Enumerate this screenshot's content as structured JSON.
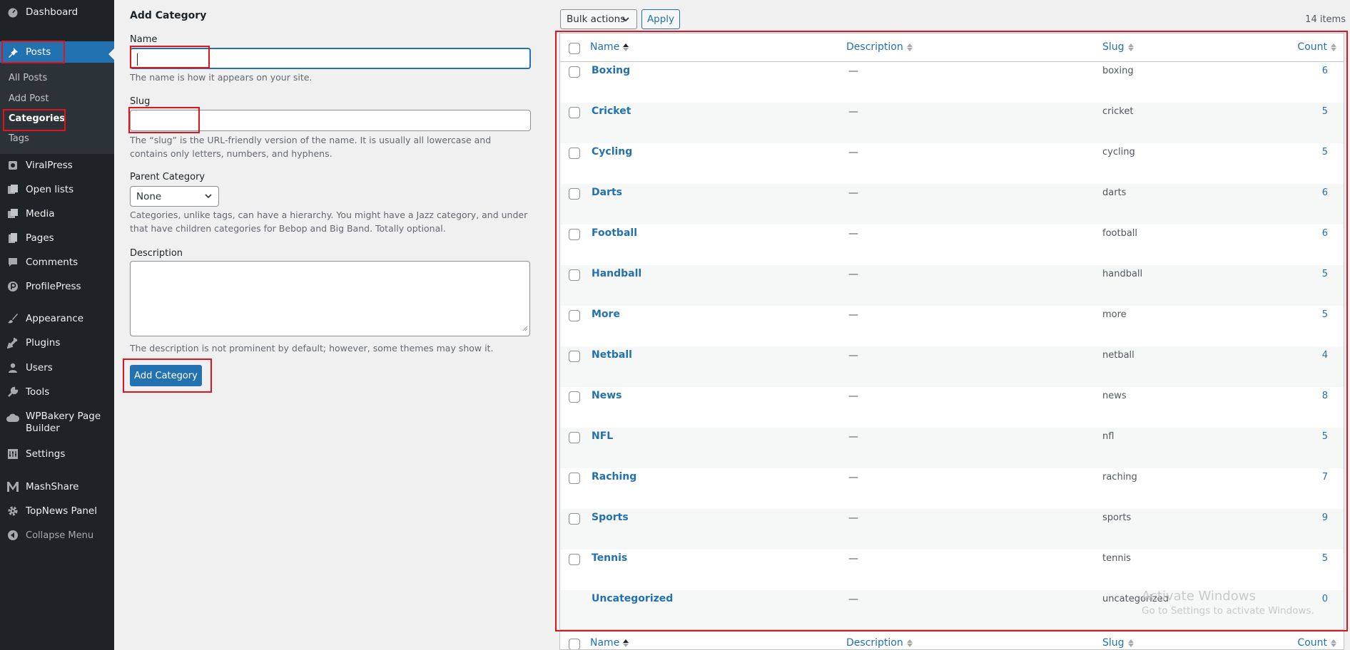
{
  "sidebar": {
    "menu": [
      {
        "label": "Dashboard",
        "icon": "dashboard-icon"
      },
      {
        "label": "Posts",
        "icon": "pushpin-icon"
      },
      {
        "label": "ViralPress",
        "icon": "viralpress-icon"
      },
      {
        "label": "Open lists",
        "icon": "list-icon"
      },
      {
        "label": "Media",
        "icon": "media-icon"
      },
      {
        "label": "Pages",
        "icon": "pages-icon"
      },
      {
        "label": "Comments",
        "icon": "comment-icon"
      },
      {
        "label": "ProfilePress",
        "icon": "profilepress-icon"
      },
      {
        "label": "Appearance",
        "icon": "brush-icon"
      },
      {
        "label": "Plugins",
        "icon": "plug-icon"
      },
      {
        "label": "Users",
        "icon": "user-icon"
      },
      {
        "label": "Tools",
        "icon": "wrench-icon"
      },
      {
        "label": "WPBakery Page Builder",
        "icon": "cloud-icon"
      },
      {
        "label": "Settings",
        "icon": "settings-icon"
      },
      {
        "label": "MashShare",
        "icon": "mashshare-icon"
      },
      {
        "label": "TopNews Panel",
        "icon": "gear-icon"
      },
      {
        "label": "Collapse Menu",
        "icon": "collapse-icon"
      }
    ],
    "posts_submenu": [
      "All Posts",
      "Add Post",
      "Categories",
      "Tags"
    ]
  },
  "form": {
    "heading": "Add Category",
    "name_label": "Name",
    "name_value": "",
    "name_help": "The name is how it appears on your site.",
    "slug_label": "Slug",
    "slug_value": "",
    "slug_help": "The “slug” is the URL-friendly version of the name. It is usually all lowercase and contains only letters, numbers, and hyphens.",
    "parent_label": "Parent Category",
    "parent_selected": "None",
    "parent_help": "Categories, unlike tags, can have a hierarchy. You might have a Jazz category, and under that have children categories for Bebop and Big Band. Totally optional.",
    "description_label": "Description",
    "description_value": "",
    "description_help": "The description is not prominent by default; however, some themes may show it.",
    "submit_label": "Add Category"
  },
  "table": {
    "bulk_actions": "Bulk actions",
    "apply": "Apply",
    "items_count": "14 items",
    "columns": {
      "name": "Name",
      "description": "Description",
      "slug": "Slug",
      "count": "Count"
    },
    "rows": [
      {
        "name": "Boxing",
        "description": "—",
        "slug": "boxing",
        "count": "6"
      },
      {
        "name": "Cricket",
        "description": "—",
        "slug": "cricket",
        "count": "5"
      },
      {
        "name": "Cycling",
        "description": "—",
        "slug": "cycling",
        "count": "5"
      },
      {
        "name": "Darts",
        "description": "—",
        "slug": "darts",
        "count": "6"
      },
      {
        "name": "Football",
        "description": "—",
        "slug": "football",
        "count": "6"
      },
      {
        "name": "Handball",
        "description": "—",
        "slug": "handball",
        "count": "5"
      },
      {
        "name": "More",
        "description": "—",
        "slug": "more",
        "count": "5"
      },
      {
        "name": "Netball",
        "description": "—",
        "slug": "netball",
        "count": "4"
      },
      {
        "name": "News",
        "description": "—",
        "slug": "news",
        "count": "8"
      },
      {
        "name": "NFL",
        "description": "—",
        "slug": "nfl",
        "count": "5"
      },
      {
        "name": "Raching",
        "description": "—",
        "slug": "raching",
        "count": "7"
      },
      {
        "name": "Sports",
        "description": "—",
        "slug": "sports",
        "count": "9"
      },
      {
        "name": "Tennis",
        "description": "—",
        "slug": "tennis",
        "count": "5"
      },
      {
        "name": "Uncategorized",
        "description": "—",
        "slug": "uncategorized",
        "count": "0"
      }
    ]
  },
  "watermark": {
    "line1": "Activate Windows",
    "line2": "Go to Settings to activate Windows."
  },
  "colors": {
    "sidebar_bg": "#1d2327",
    "accent": "#2271b1",
    "highlight": "#e0141e",
    "page_bg": "#f0f0f1"
  }
}
